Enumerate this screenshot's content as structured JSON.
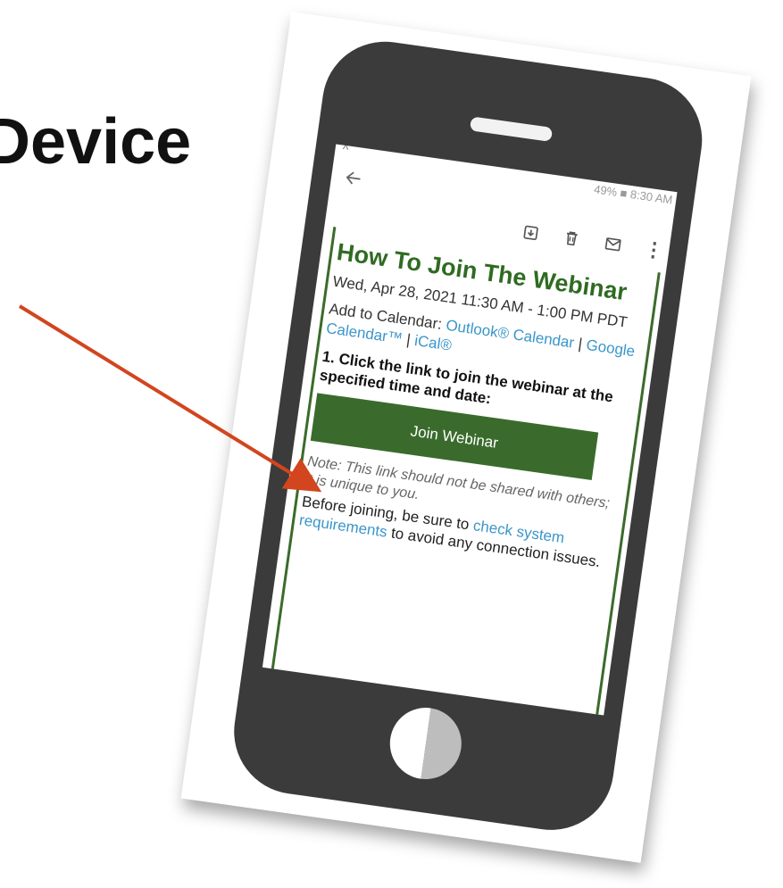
{
  "slide": {
    "heading": "Device"
  },
  "phone": {
    "status_text": "49% ■ 8:30 AM",
    "up_icon": "^",
    "back_icon": "arrow-left-icon",
    "toolbar_icons": [
      "archive-icon",
      "trash-icon",
      "mail-icon",
      "more-vert-icon"
    ],
    "more_glyph": "⋮"
  },
  "email": {
    "title": "How To Join The Webinar",
    "date": "Wed, Apr 28, 2021 11:30 AM - 1:00 PM PDT",
    "calendar_prefix": "Add to Calendar: ",
    "calendar_links": [
      "Outlook® Calendar",
      "Google Calendar™",
      "iCal®"
    ],
    "separator": " | ",
    "step": "1. Click the link to join the webinar at the specified time and date:",
    "join_button": "Join Webinar",
    "note": "Note: This link should not be shared with others; it is unique to you.",
    "before_prefix": "Before joining, be sure to ",
    "check_link": "check system requirements",
    "before_suffix": " to avoid any connection issues."
  },
  "colors": {
    "accent_green": "#3a6b2c",
    "title_green": "#2f6b22",
    "link_blue": "#3a96c9",
    "arrow_red": "#d2451e",
    "phone_body": "#3b3b3b"
  }
}
